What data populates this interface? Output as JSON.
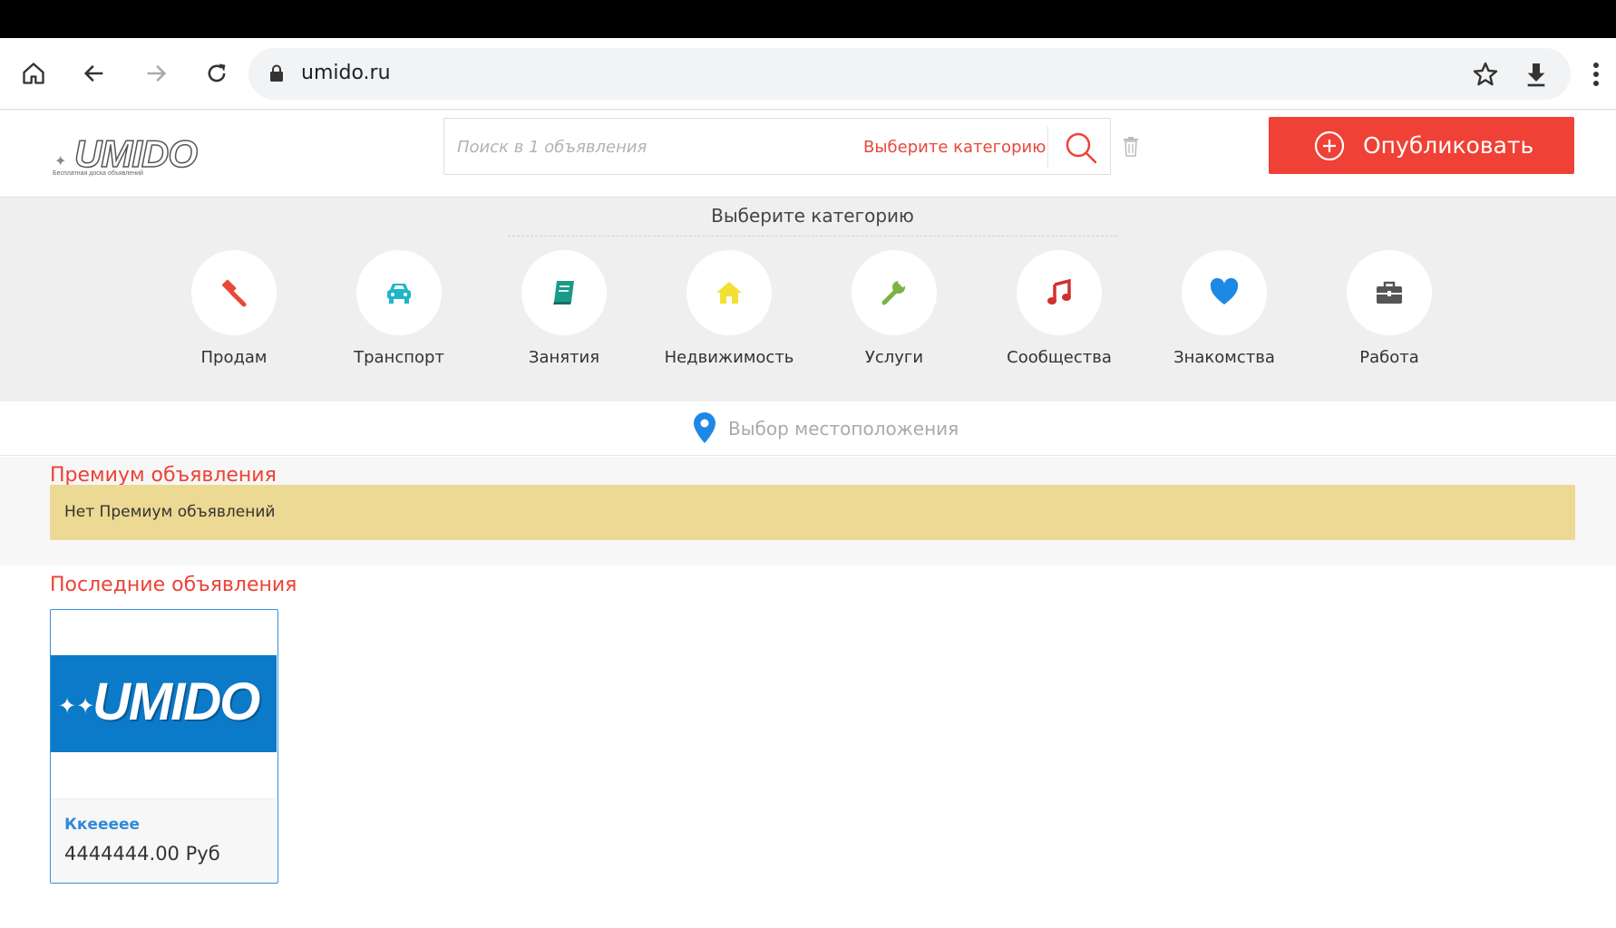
{
  "browser": {
    "url": "umido.ru",
    "icons": [
      "home-icon",
      "back-icon",
      "forward-icon",
      "reload-icon",
      "lock-icon",
      "star-icon",
      "download-icon",
      "more-vert-icon"
    ]
  },
  "header": {
    "logo_text": "UMIDO",
    "logo_tagline": "Бесплатная доска объявлений",
    "search_placeholder": "Поиск в 1 объявления",
    "search_category": "Выберите категорию",
    "publish_label": "Опубликовать"
  },
  "categories": {
    "title": "Выберите категорию",
    "items": [
      {
        "label": "Продам",
        "icon": "gavel-icon",
        "color": "#e8483a"
      },
      {
        "label": "Транспорт",
        "icon": "car-icon",
        "color": "#1fb6c9"
      },
      {
        "label": "Занятия",
        "icon": "book-icon",
        "color": "#1a9a8a"
      },
      {
        "label": "Недвижимость",
        "icon": "home-icon",
        "color": "#f2e132"
      },
      {
        "label": "Услуги",
        "icon": "wrench-icon",
        "color": "#7cb342"
      },
      {
        "label": "Сообщества",
        "icon": "music-icon",
        "color": "#d32f2f"
      },
      {
        "label": "Знакомства",
        "icon": "heart-icon",
        "color": "#1e88e5"
      },
      {
        "label": "Работа",
        "icon": "briefcase-icon",
        "color": "#555555"
      }
    ]
  },
  "location": {
    "label": "Выбор местоположения"
  },
  "premium": {
    "title": "Премиум объявления",
    "empty_message": "Нет Премиум объявлений"
  },
  "latest": {
    "title": "Последние объявления",
    "listings": [
      {
        "image_text": "UMIDO",
        "title": "Ккееееe",
        "price": "4444444.00 Руб"
      }
    ]
  },
  "colors": {
    "accent": "#ef4135",
    "link": "#2f8ad8",
    "premium_bg": "#ecd993",
    "card_image_bg": "#0b7ac9"
  }
}
